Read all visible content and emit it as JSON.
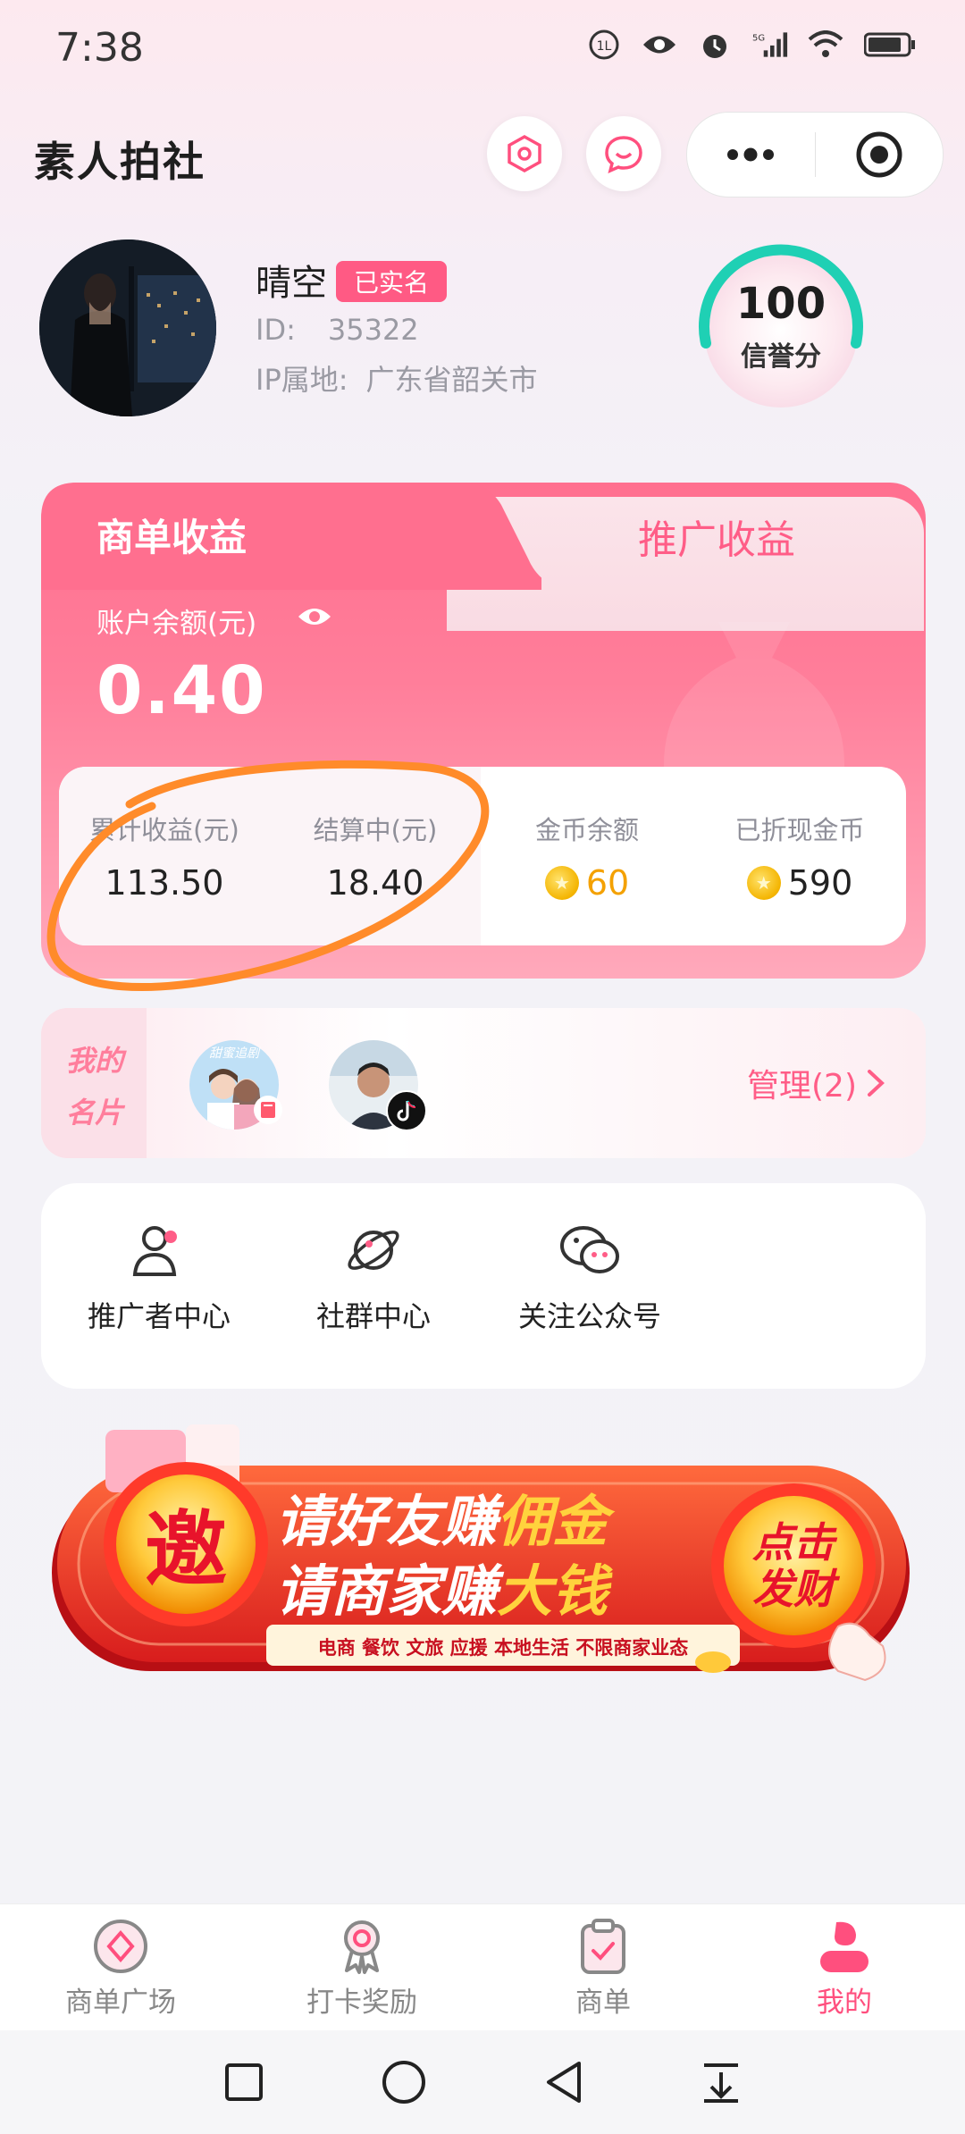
{
  "status_bar": {
    "time": "7:38"
  },
  "app": {
    "title": "素人拍社"
  },
  "profile": {
    "nickname": "晴空",
    "verified_badge": "已实名",
    "id_label": "ID:",
    "id_value": "35322",
    "ip_label": "IP属地:",
    "ip_value": "广东省韶关市",
    "credit_score": "100",
    "credit_label": "信誉分",
    "credit_ratio": 1.0
  },
  "earnings": {
    "tab_active": "商单收益",
    "tab_inactive": "推广收益",
    "balance_label": "账户余额(元)",
    "balance_value": "0.40",
    "stats": [
      {
        "label": "累计收益(元)",
        "value": "113.50"
      },
      {
        "label": "结算中(元)",
        "value": "18.40"
      },
      {
        "label": "金币余额",
        "value": "60"
      },
      {
        "label": "已折现金币",
        "value": "590"
      }
    ]
  },
  "cards": {
    "tag": [
      "我的",
      "名片"
    ],
    "manage_label": "管理(2)",
    "avatar1_text": "甜蜜追剧"
  },
  "menu": {
    "items": [
      {
        "label": "推广者中心",
        "icon": "user-group-icon"
      },
      {
        "label": "社群中心",
        "icon": "planet-icon"
      },
      {
        "label": "关注公众号",
        "icon": "wechat-icon"
      }
    ]
  },
  "banner": {
    "badge": "邀",
    "line1_a": "请好友赚",
    "line1_b": "佣金",
    "line2_a": "请商家赚",
    "line2_b": "大钱",
    "cta": [
      "点击",
      "发财"
    ],
    "sub": "电商 餐饮 文旅 应援 本地生活 不限商家业态"
  },
  "tabbar": {
    "items": [
      {
        "label": "商单广场",
        "icon": "plaza-icon",
        "active": false
      },
      {
        "label": "打卡奖励",
        "icon": "medal-icon",
        "active": false
      },
      {
        "label": "商单",
        "icon": "clipboard-icon",
        "active": false
      },
      {
        "label": "我的",
        "icon": "profile-icon",
        "active": true
      }
    ]
  },
  "colors": {
    "accent": "#ff5d87",
    "active_tab": "#ff4f7e",
    "gold": "#f4a100",
    "credit_arc": "#1fd0b4"
  }
}
